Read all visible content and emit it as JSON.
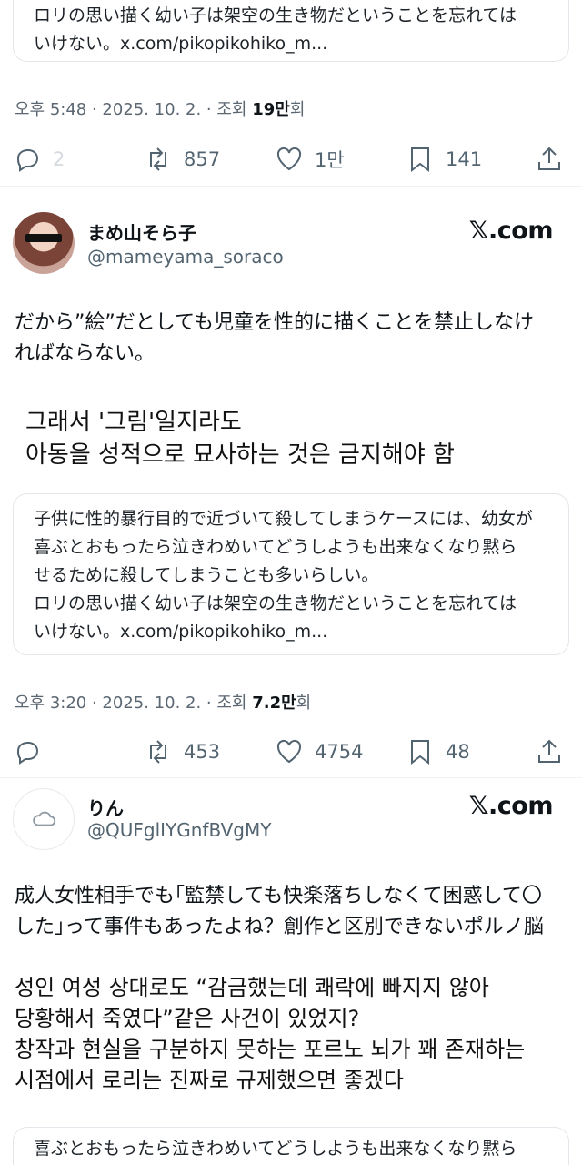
{
  "tweet1": {
    "quote_text": "ロリの思い描く幼い子は架空の生き物だということを忘れては\nいけない。x.com/pikopikohiko_m...",
    "meta_prefix": "오후 5:48 · 2025. 10. 2. · 조회 ",
    "views": "19만",
    "views_suffix": "회",
    "replies": "2",
    "reposts": "857",
    "likes": "1만",
    "bookmarks": "141"
  },
  "tweet2": {
    "name": "まめ山そら子",
    "handle": "@mameyama_soraco",
    "source": "𝕏.com",
    "text": "だから”絵”だとしても児童を性的に描くことを禁止しなけ\nればならない。",
    "translation": "그래서 '그림'일지라도\n아동을 성적으로 묘사하는 것은 금지해야 함",
    "quote_text": "子供に性的暴行目的で近づいて殺してしまうケースには、幼女が\n喜ぶとおもったら泣きわめいてどうしようも出来なくなり黙ら\nせるために殺してしまうことも多いらしい。\nロリの思い描く幼い子は架空の生き物だということを忘れては\nいけない。x.com/pikopikohiko_m...",
    "meta_prefix": "오후 3:20 · 2025. 10. 2. · 조회 ",
    "views": "7.2만",
    "views_suffix": "회",
    "reposts": "453",
    "likes": "4754",
    "bookmarks": "48"
  },
  "tweet3": {
    "name": "りん",
    "handle": "@QUFglIYGnfBVgMY",
    "source": "𝕏.com",
    "text": "成人女性相手でも｢監禁しても快楽落ちしなくて困惑して〇\nした｣って事件もあったよね？創作と区別できないポルノ脳",
    "translation": "성인 여성 상대로도 “감금했는데 쾌락에 빠지지 않아\n당황해서 죽였다”같은 사건이 있었지?\n창작과 현실을 구분하지 못하는 포르노 뇌가 꽤 존재하는\n시점에서 로리는 진짜로 규제했으면 좋겠다",
    "quote_text": "喜ぶとおもったら泣きわめいてどうしようも出来なくなり黙ら"
  }
}
